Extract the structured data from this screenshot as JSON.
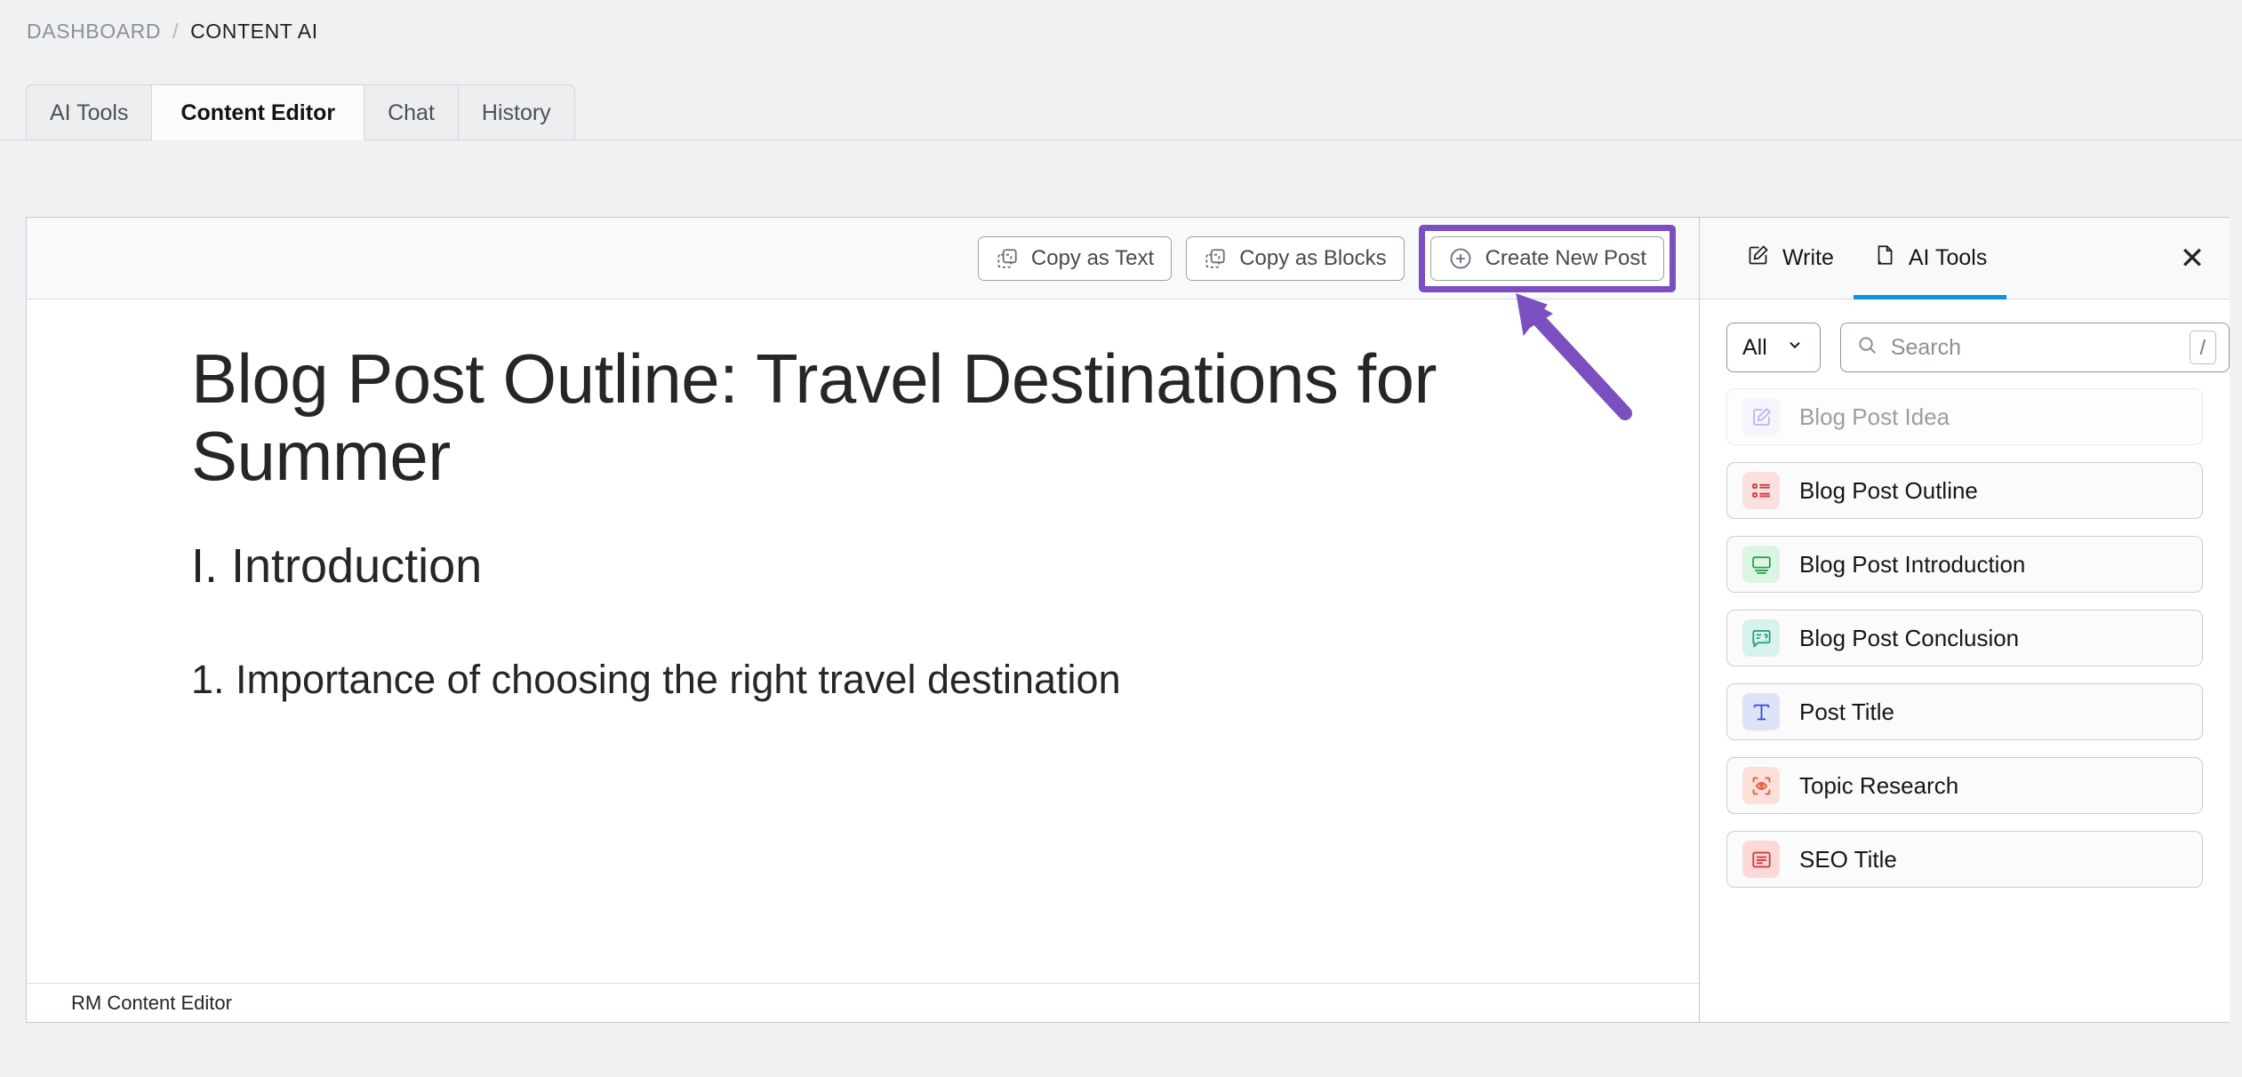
{
  "breadcrumb": {
    "root": "DASHBOARD",
    "separator": "/",
    "current": "CONTENT AI"
  },
  "tabs": [
    {
      "label": "AI Tools",
      "active": false
    },
    {
      "label": "Content Editor",
      "active": true
    },
    {
      "label": "Chat",
      "active": false
    },
    {
      "label": "History",
      "active": false
    }
  ],
  "toolbar": {
    "copy_as_text": "Copy as Text",
    "copy_as_blocks": "Copy as Blocks",
    "create_new_post": "Create New Post",
    "highlight_color": "#7b4fc0"
  },
  "document": {
    "title": "Blog Post Outline: Travel Destinations for Summer",
    "heading_section": "I. Introduction",
    "heading_item": "1. Importance of choosing the right travel destination"
  },
  "statusbar": {
    "label": "RM Content Editor"
  },
  "panel": {
    "tabs": [
      {
        "label": "Write",
        "active": false
      },
      {
        "label": "AI Tools",
        "active": true
      }
    ],
    "active_accent": "#0b96d6",
    "close_label": "✕",
    "filter": {
      "value": "All"
    },
    "search": {
      "value": "",
      "placeholder": "Search",
      "shortcut": "/"
    },
    "tools": [
      {
        "label": "Blog Post Idea",
        "icon": "pencil-square-icon",
        "icon_bg": "#ece7fb",
        "icon_color": "#6b4fc9",
        "faded": true
      },
      {
        "label": "Blog Post Outline",
        "icon": "list-bullet-icon",
        "icon_bg": "#fbe0e0",
        "icon_color": "#d13b3b",
        "faded": false
      },
      {
        "label": "Blog Post Introduction",
        "icon": "monitor-lines-icon",
        "icon_bg": "#dcf5e2",
        "icon_color": "#2f9e50",
        "faded": false
      },
      {
        "label": "Blog Post Conclusion",
        "icon": "chat-question-icon",
        "icon_bg": "#d8f2ec",
        "icon_color": "#1f9c84",
        "faded": false
      },
      {
        "label": "Post Title",
        "icon": "text-title-icon",
        "icon_bg": "#dde3f7",
        "icon_color": "#2f4fc4",
        "faded": false
      },
      {
        "label": "Topic Research",
        "icon": "scan-eye-icon",
        "icon_bg": "#fbdfd8",
        "icon_color": "#e05a3b",
        "faded": false
      },
      {
        "label": "SEO Title",
        "icon": "list-red-icon",
        "icon_bg": "#fbd9d9",
        "icon_color": "#d13b3b",
        "faded": false
      }
    ]
  },
  "annotation": {
    "type": "arrow",
    "color": "#7b4fc0",
    "points_to": "create-new-post-button"
  }
}
